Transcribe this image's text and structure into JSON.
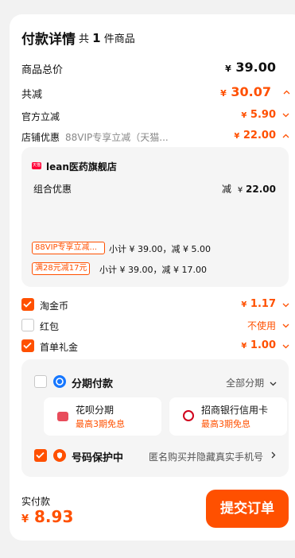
{
  "header": {
    "title": "付款详情",
    "count_prefix": "共",
    "count": "1",
    "count_suffix": "件商品"
  },
  "rows": {
    "total": {
      "label": "商品总价",
      "currency": "¥",
      "value": "39.00"
    },
    "discount": {
      "label": "共减",
      "currency": "¥",
      "value": "30.07"
    },
    "official": {
      "label": "官方立减",
      "currency": "¥",
      "value": "5.90"
    },
    "store": {
      "label": "店铺优惠",
      "desc": "88VIP专享立减（天猫...",
      "currency": "¥",
      "value": "22.00"
    }
  },
  "store_panel": {
    "logo_text": "天猫",
    "name": "lean医药旗舰店",
    "combo_label": "组合优惠",
    "combo_prefix": "减",
    "combo_currency": "¥",
    "combo_value": "22.00",
    "promos": [
      {
        "tag": "88VIP专享立减...",
        "text": "小计 ¥ 39.00，减 ¥ 5.00"
      },
      {
        "tag": "满28元减17元",
        "text": "小计 ¥ 39.00，减 ¥ 17.00"
      }
    ]
  },
  "options": {
    "taojinbi": {
      "label": "淘金币",
      "currency": "¥",
      "value": "1.17",
      "checked": true
    },
    "hongbao": {
      "label": "红包",
      "value": "不使用",
      "checked": false
    },
    "first_order": {
      "label": "首单礼金",
      "currency": "¥",
      "value": "1.00",
      "checked": true
    }
  },
  "installment": {
    "label": "分期付款",
    "right_label": "全部分期",
    "cards": [
      {
        "name": "花呗分期",
        "sub": "最高3期免息"
      },
      {
        "name": "招商银行信用卡",
        "sub": "最高3期免息"
      }
    ]
  },
  "privacy": {
    "label": "号码保护中",
    "desc": "匿名购买并隐藏真实手机号"
  },
  "footer": {
    "label": "实付款",
    "currency": "¥",
    "value": "8.93",
    "submit": "提交订单"
  },
  "colors": {
    "accent": "#ff5000",
    "panel": "#f5f5f5",
    "background": "#f2f2f2"
  }
}
